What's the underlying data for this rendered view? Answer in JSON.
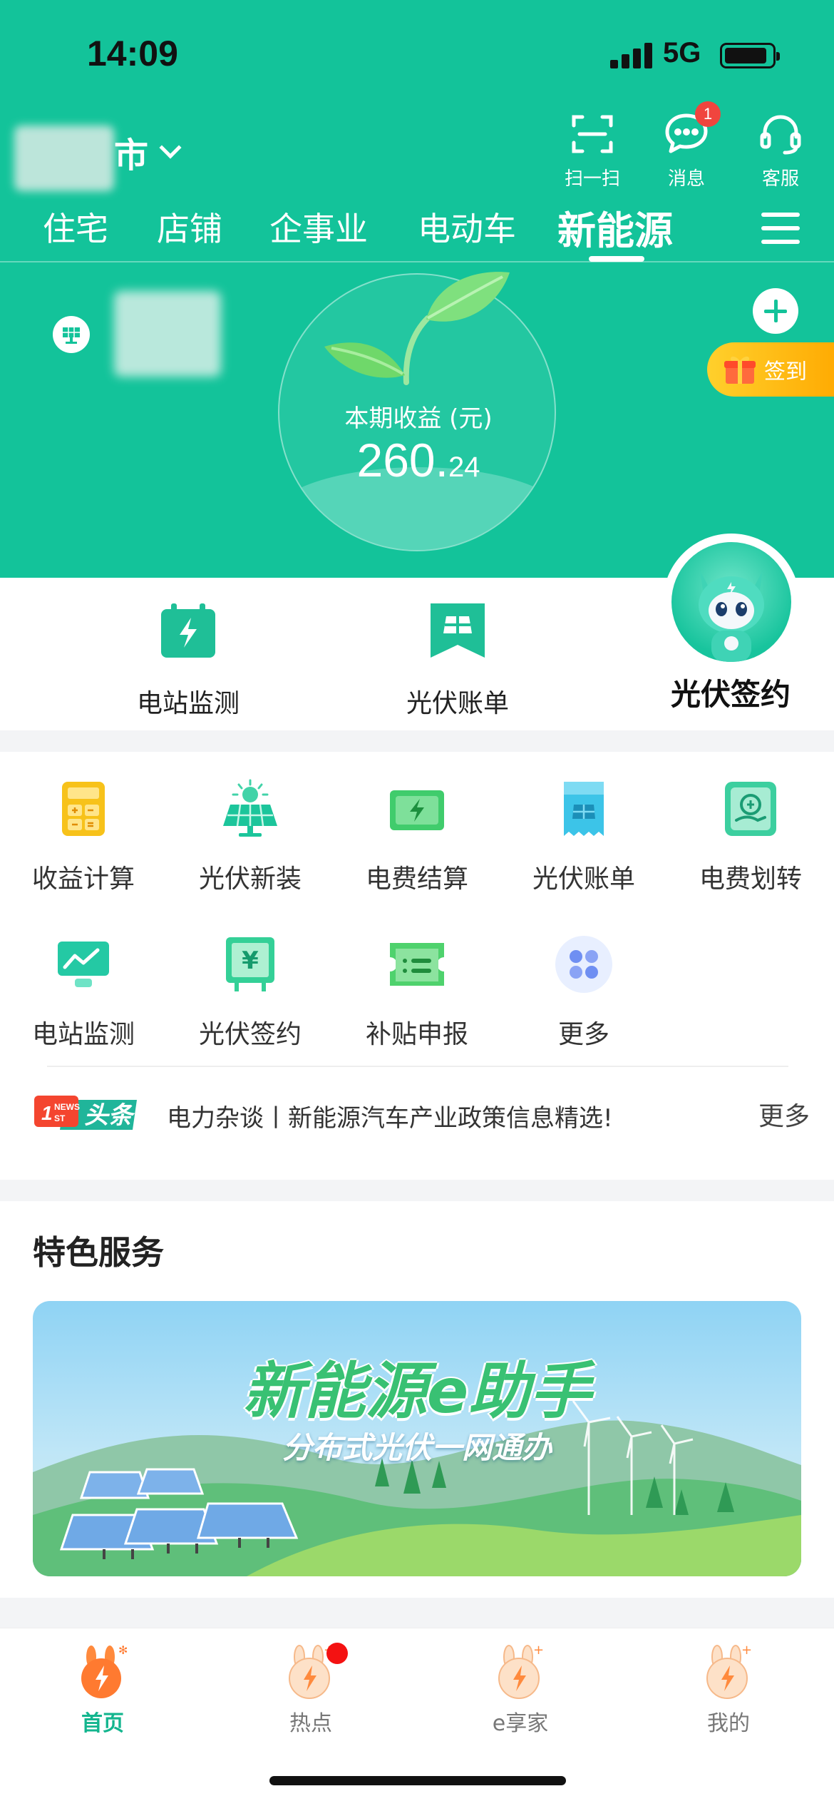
{
  "status_bar": {
    "time": "14:09",
    "network": "5G"
  },
  "header": {
    "city_suffix": "市",
    "actions": [
      {
        "label": "扫一扫",
        "icon": "scan-icon"
      },
      {
        "label": "消息",
        "icon": "message-icon",
        "badge": "1"
      },
      {
        "label": "客服",
        "icon": "headset-icon"
      }
    ],
    "tabs": [
      "住宅",
      "店铺",
      "企事业",
      "电动车",
      "新能源"
    ],
    "active_tab": "新能源"
  },
  "gauge": {
    "label": "本期收益 (元)",
    "value_int": "260.",
    "value_dec": "24"
  },
  "signin_label": "签到",
  "quick_entries": [
    {
      "label": "电站监测",
      "icon": "station-monitor-icon"
    },
    {
      "label": "光伏账单",
      "icon": "pv-bill-icon"
    },
    {
      "label": "光伏签约",
      "icon": "mascot-icon"
    }
  ],
  "services": [
    {
      "label": "收益计算",
      "icon": "calculator-icon",
      "color": "#f5c017"
    },
    {
      "label": "光伏新装",
      "icon": "solar-panel-icon",
      "color": "#1cc59b"
    },
    {
      "label": "电费结算",
      "icon": "bill-settle-icon",
      "color": "#38c769"
    },
    {
      "label": "光伏账单",
      "icon": "pv-receipt-icon",
      "color": "#27b8e0"
    },
    {
      "label": "电费划转",
      "icon": "transfer-icon",
      "color": "#2ec497"
    },
    {
      "label": "电站监测",
      "icon": "monitor-icon",
      "color": "#1ec7a3"
    },
    {
      "label": "光伏签约",
      "icon": "sign-contract-icon",
      "color": "#2ccf8f"
    },
    {
      "label": "补贴申报",
      "icon": "subsidy-icon",
      "color": "#4cd06b"
    },
    {
      "label": "更多",
      "icon": "more-icon",
      "color": "#6c8cf0"
    }
  ],
  "news": {
    "tag": "头条",
    "text": "电力杂谈丨新能源汽车产业政策信息精选!",
    "more": "更多"
  },
  "feature": {
    "title": "特色服务",
    "banner_title": "新能源e助手",
    "banner_subtitle": "分布式光伏一网通办"
  },
  "bottom_nav": [
    {
      "label": "首页",
      "icon": "home-bunny-icon",
      "active": true
    },
    {
      "label": "热点",
      "icon": "hot-bunny-icon",
      "active": false
    },
    {
      "label": "e享家",
      "icon": "ehome-bunny-icon",
      "active": false
    },
    {
      "label": "我的",
      "icon": "mine-bunny-icon",
      "active": false
    }
  ],
  "colors": {
    "brand": "#13c39a",
    "accent_orange": "#ffa900",
    "badge_red": "#f0453e"
  }
}
